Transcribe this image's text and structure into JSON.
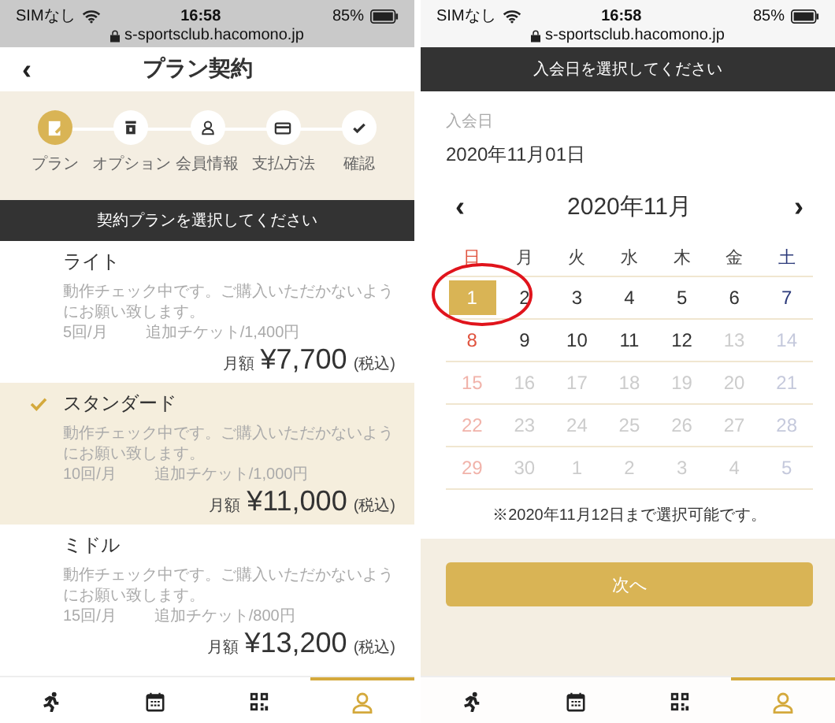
{
  "left_screen": {
    "status_bar": {
      "carrier": "SIMなし",
      "time": "16:58",
      "battery": "85%",
      "url": "s-sportsclub.hacomono.jp"
    },
    "header": {
      "back": "‹",
      "title": "プラン契約"
    },
    "steps": [
      {
        "label": "プラン",
        "kind": "plan",
        "selected": true
      },
      {
        "label": "オプション",
        "kind": "option",
        "selected": false
      },
      {
        "label": "会員情報",
        "kind": "member",
        "selected": false
      },
      {
        "label": "支払方法",
        "kind": "card",
        "selected": false
      },
      {
        "label": "確認",
        "kind": "check",
        "selected": false
      }
    ],
    "banner": "契約プランを選択してください",
    "plans": [
      {
        "name": "ライト",
        "description": "動作チェック中です。ご購入いただかないようにお願い致します。",
        "count": "5回/月",
        "ticket": "追加チケット/1,400円",
        "price_prefix": "月額",
        "price": "¥7,700",
        "tax": "(税込)",
        "selected": false
      },
      {
        "name": "スタンダード",
        "description": "動作チェック中です。ご購入いただかないようにお願い致します。",
        "count": "10回/月",
        "ticket": "追加チケット/1,000円",
        "price_prefix": "月額",
        "price": "¥11,000",
        "tax": "(税込)",
        "selected": true
      },
      {
        "name": "ミドル",
        "description": "動作チェック中です。ご購入いただかないようにお願い致します。",
        "count": "15回/月",
        "ticket": "追加チケット/800円",
        "price_prefix": "月額",
        "price": "¥13,200",
        "tax": "(税込)",
        "selected": false
      }
    ],
    "tab_bar": [
      {
        "kind": "run",
        "selected": false
      },
      {
        "kind": "calendar",
        "selected": false
      },
      {
        "kind": "qr",
        "selected": false
      },
      {
        "kind": "person",
        "selected": true
      }
    ]
  },
  "right_screen": {
    "status_bar": {
      "carrier": "SIMなし",
      "time": "16:58",
      "battery": "85%",
      "url": "s-sportsclub.hacomono.jp"
    },
    "banner": "入会日を選択してください",
    "field_label": "入会日",
    "field_value": "2020年11月01日",
    "calendar": {
      "prev": "‹",
      "month": "2020年11月",
      "next": "›",
      "weekdays": [
        {
          "label": "日",
          "kind": "sunday"
        },
        {
          "label": "月",
          "kind": "weekday"
        },
        {
          "label": "火",
          "kind": "weekday"
        },
        {
          "label": "水",
          "kind": "weekday"
        },
        {
          "label": "木",
          "kind": "weekday"
        },
        {
          "label": "金",
          "kind": "weekday"
        },
        {
          "label": "土",
          "kind": "saturday"
        }
      ],
      "weeks": [
        [
          {
            "day": "1",
            "kind": "sunday",
            "disabled": false,
            "selected": true
          },
          {
            "day": "2",
            "kind": "weekday",
            "disabled": false,
            "selected": false
          },
          {
            "day": "3",
            "kind": "weekday",
            "disabled": false,
            "selected": false
          },
          {
            "day": "4",
            "kind": "weekday",
            "disabled": false,
            "selected": false
          },
          {
            "day": "5",
            "kind": "weekday",
            "disabled": false,
            "selected": false
          },
          {
            "day": "6",
            "kind": "weekday",
            "disabled": false,
            "selected": false
          },
          {
            "day": "7",
            "kind": "saturday",
            "disabled": false,
            "selected": false
          }
        ],
        [
          {
            "day": "8",
            "kind": "sunday",
            "disabled": false,
            "selected": false
          },
          {
            "day": "9",
            "kind": "weekday",
            "disabled": false,
            "selected": false
          },
          {
            "day": "10",
            "kind": "weekday",
            "disabled": false,
            "selected": false
          },
          {
            "day": "11",
            "kind": "weekday",
            "disabled": false,
            "selected": false
          },
          {
            "day": "12",
            "kind": "weekday",
            "disabled": false,
            "selected": false
          },
          {
            "day": "13",
            "kind": "weekday",
            "disabled": true,
            "selected": false
          },
          {
            "day": "14",
            "kind": "saturday",
            "disabled": true,
            "selected": false
          }
        ],
        [
          {
            "day": "15",
            "kind": "sunday",
            "disabled": true,
            "selected": false
          },
          {
            "day": "16",
            "kind": "weekday",
            "disabled": true,
            "selected": false
          },
          {
            "day": "17",
            "kind": "weekday",
            "disabled": true,
            "selected": false
          },
          {
            "day": "18",
            "kind": "weekday",
            "disabled": true,
            "selected": false
          },
          {
            "day": "19",
            "kind": "weekday",
            "disabled": true,
            "selected": false
          },
          {
            "day": "20",
            "kind": "weekday",
            "disabled": true,
            "selected": false
          },
          {
            "day": "21",
            "kind": "saturday",
            "disabled": true,
            "selected": false
          }
        ],
        [
          {
            "day": "22",
            "kind": "sunday",
            "disabled": true,
            "selected": false
          },
          {
            "day": "23",
            "kind": "weekday",
            "disabled": true,
            "selected": false
          },
          {
            "day": "24",
            "kind": "weekday",
            "disabled": true,
            "selected": false
          },
          {
            "day": "25",
            "kind": "weekday",
            "disabled": true,
            "selected": false
          },
          {
            "day": "26",
            "kind": "weekday",
            "disabled": true,
            "selected": false
          },
          {
            "day": "27",
            "kind": "weekday",
            "disabled": true,
            "selected": false
          },
          {
            "day": "28",
            "kind": "saturday",
            "disabled": true,
            "selected": false
          }
        ],
        [
          {
            "day": "29",
            "kind": "sunday",
            "disabled": true,
            "selected": false
          },
          {
            "day": "30",
            "kind": "weekday",
            "disabled": true,
            "selected": false
          },
          {
            "day": "1",
            "kind": "weekday",
            "disabled": true,
            "selected": false
          },
          {
            "day": "2",
            "kind": "weekday",
            "disabled": true,
            "selected": false
          },
          {
            "day": "3",
            "kind": "weekday",
            "disabled": true,
            "selected": false
          },
          {
            "day": "4",
            "kind": "weekday",
            "disabled": true,
            "selected": false
          },
          {
            "day": "5",
            "kind": "saturday",
            "disabled": true,
            "selected": false
          }
        ]
      ]
    },
    "note": "※2020年11月12日まで選択可能です。",
    "next_button": "次へ",
    "tab_bar": [
      {
        "kind": "run",
        "selected": false
      },
      {
        "kind": "calendar",
        "selected": false
      },
      {
        "kind": "qr",
        "selected": false
      },
      {
        "kind": "person",
        "selected": true
      }
    ]
  }
}
